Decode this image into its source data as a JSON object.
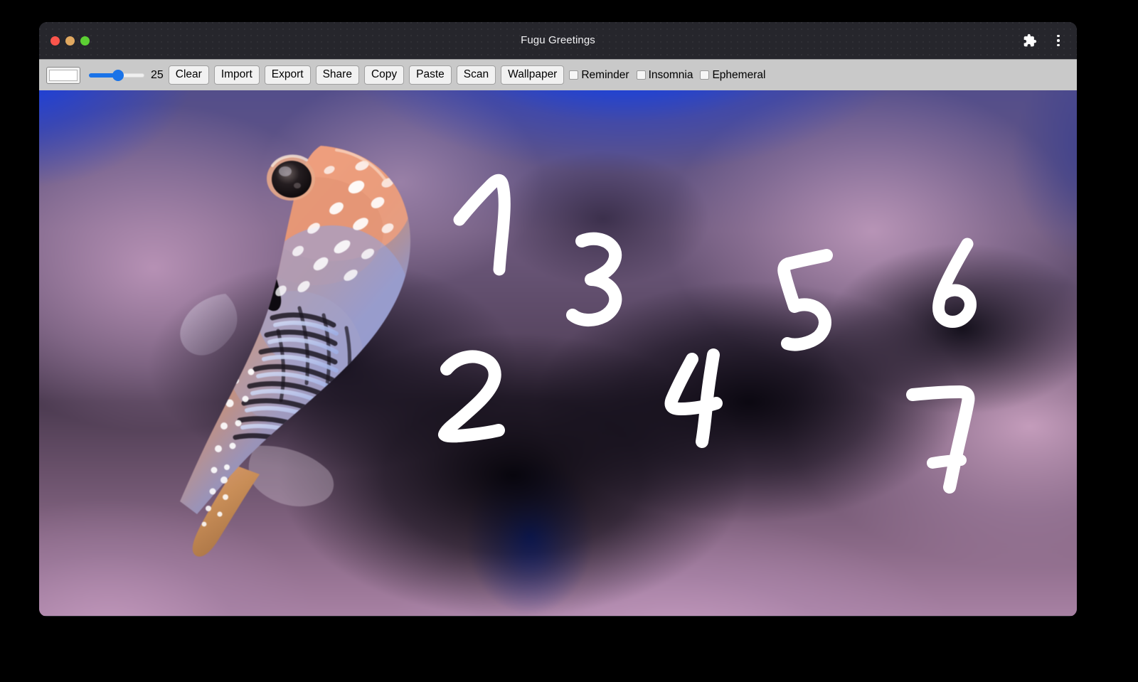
{
  "window": {
    "title": "Fugu Greetings",
    "traffic_lights": [
      {
        "name": "close",
        "color": "#fb554c"
      },
      {
        "name": "minimize",
        "color": "#e0a860"
      },
      {
        "name": "maximize",
        "color": "#5ccf33"
      }
    ],
    "title_actions": [
      {
        "name": "extensions-icon",
        "glyph": "puzzle"
      },
      {
        "name": "more-menu-icon",
        "glyph": "kebab"
      }
    ]
  },
  "toolbar": {
    "color_picker": {
      "label": "color",
      "value": "#ffffff"
    },
    "brush_slider": {
      "value": "25",
      "min": "1",
      "max": "50",
      "fill_color": "#1a73e8"
    },
    "buttons": [
      {
        "id": "clear",
        "label": "Clear"
      },
      {
        "id": "import",
        "label": "Import"
      },
      {
        "id": "export",
        "label": "Export"
      },
      {
        "id": "share",
        "label": "Share"
      },
      {
        "id": "copy",
        "label": "Copy"
      },
      {
        "id": "paste",
        "label": "Paste"
      },
      {
        "id": "scan",
        "label": "Scan"
      },
      {
        "id": "wallpaper",
        "label": "Wallpaper"
      }
    ],
    "checkboxes": [
      {
        "id": "reminder",
        "label": "Reminder",
        "checked": false
      },
      {
        "id": "insomnia",
        "label": "Insomnia",
        "checked": false
      },
      {
        "id": "ephemeral",
        "label": "Ephemeral",
        "checked": false
      }
    ]
  },
  "canvas": {
    "background_image": "blurred underwater aquarium photo with pufferfish",
    "subject": "pufferfish (fugu)",
    "stroke_color": "#ffffff",
    "drawn_digits": [
      "1",
      "2",
      "3",
      "4",
      "5",
      "6",
      "7"
    ]
  }
}
